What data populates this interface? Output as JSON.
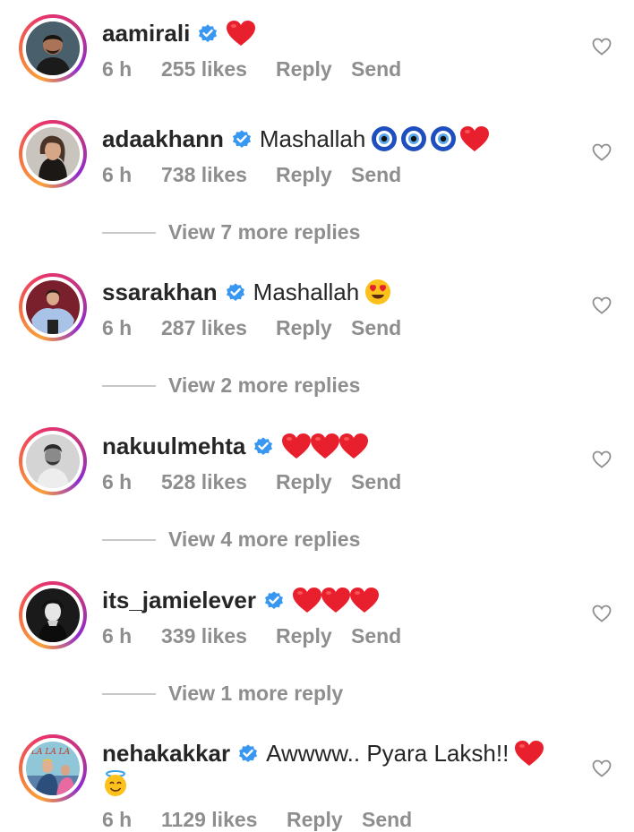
{
  "colors": {
    "text": "#262626",
    "secondary": "#8e8e8e",
    "verified": "#3897f0",
    "heart": "#e8202e"
  },
  "comments": [
    {
      "username": "aamirali",
      "text": "",
      "emojis": [
        "red-heart"
      ],
      "time": "6 h",
      "likes": "255 likes",
      "reply_label": "Reply",
      "send_label": "Send",
      "view_replies": ""
    },
    {
      "username": "adaakhann",
      "text": "Mashallah",
      "emojis": [
        "nazar-amulet",
        "nazar-amulet",
        "nazar-amulet",
        "red-heart"
      ],
      "time": "6 h",
      "likes": "738 likes",
      "reply_label": "Reply",
      "send_label": "Send",
      "view_replies": "View 7 more replies"
    },
    {
      "username": "ssarakhan",
      "text": "Mashallah",
      "emojis": [
        "heart-eyes-face"
      ],
      "time": "6 h",
      "likes": "287 likes",
      "reply_label": "Reply",
      "send_label": "Send",
      "view_replies": "View 2 more replies"
    },
    {
      "username": "nakuulmehta",
      "text": "",
      "emojis": [
        "red-heart",
        "red-heart",
        "red-heart"
      ],
      "time": "6 h",
      "likes": "528 likes",
      "reply_label": "Reply",
      "send_label": "Send",
      "view_replies": "View 4 more replies"
    },
    {
      "username": "its_jamielever",
      "text": "",
      "emojis": [
        "red-heart",
        "red-heart",
        "red-heart"
      ],
      "time": "6 h",
      "likes": "339 likes",
      "reply_label": "Reply",
      "send_label": "Send",
      "view_replies": "View 1 more reply"
    },
    {
      "username": "nehakakkar",
      "text": "Awwww.. Pyara Laksh!!",
      "emojis": [
        "red-heart",
        "halo-smiling-face"
      ],
      "time": "6 h",
      "likes": "1129 likes",
      "reply_label": "Reply",
      "send_label": "Send",
      "view_replies": "",
      "avatar_caption": "LA LA LA"
    }
  ],
  "icons": {
    "verified": "verified-badge-icon",
    "like": "heart-outline-icon"
  }
}
